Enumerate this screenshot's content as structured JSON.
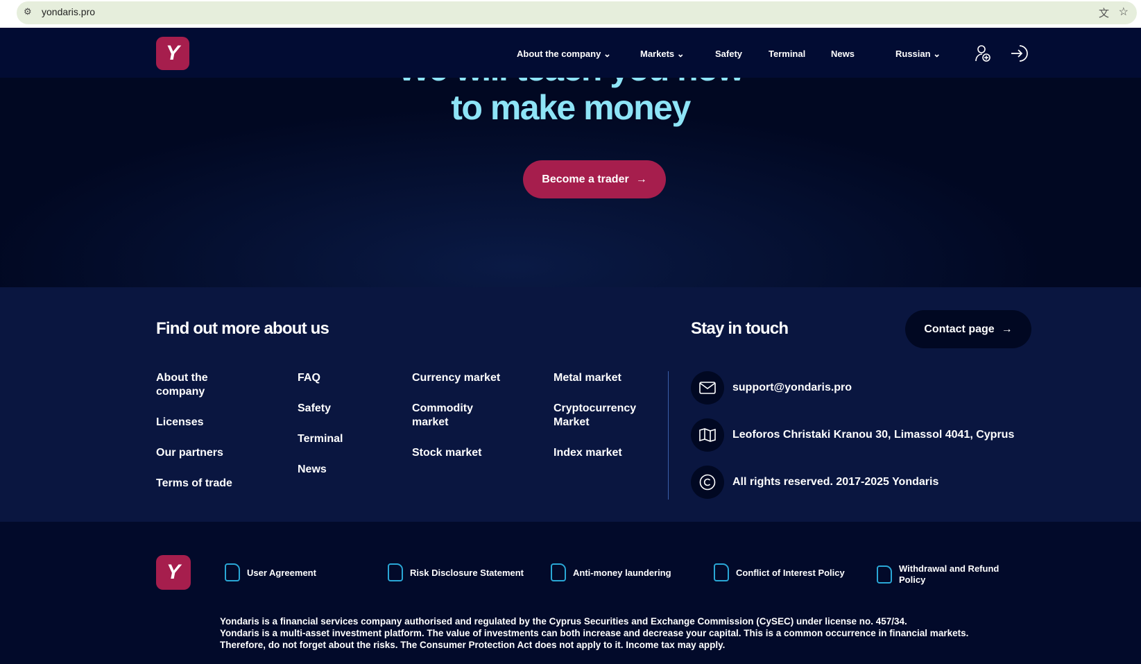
{
  "browser": {
    "url": "yondaris.pro"
  },
  "nav": {
    "logo": "Y",
    "items": [
      {
        "label": "About the company"
      },
      {
        "label": "Markets"
      },
      {
        "label": "Safety"
      },
      {
        "label": "Terminal"
      },
      {
        "label": "News"
      }
    ],
    "language": "Russian"
  },
  "hero": {
    "title_line1": "We will teach you how",
    "title_line2": "to make money",
    "cta": "Become a trader"
  },
  "footer": {
    "about_title": "Find out more about us",
    "columns": [
      [
        "About the company",
        "Licenses",
        "Our partners",
        "Terms of trade"
      ],
      [
        "FAQ",
        "Safety",
        "Terminal",
        "News"
      ],
      [
        "Currency market",
        "Commodity market",
        "Stock market"
      ],
      [
        "Metal market",
        "Cryptocurrency Market",
        "Index market"
      ]
    ],
    "contact_title": "Stay in touch",
    "contact_button": "Contact page",
    "email": "support@yondaris.pro",
    "address": "Leoforos Christaki Kranou 30, Limassol 4041, Cyprus",
    "copyright": "All rights reserved. 2017-2025 Yondaris"
  },
  "documents": [
    "User Agreement",
    "Risk Disclosure Statement",
    "Anti-money laundering",
    "Conflict of Interest Policy",
    "Withdrawal and Refund Policy"
  ],
  "disclaimer": [
    "Yondaris is a financial services company authorised and regulated by the Cyprus Securities and Exchange Commission (CySEC) under license no. 457/34.",
    "Yondaris is a multi-asset investment platform. The value of investments can both increase and decrease your capital. This is a common occurrence in financial markets.",
    "Therefore, do not forget about the risks. The Consumer Protection Act does not apply to it. Income tax may apply."
  ],
  "colors": {
    "accent": "#a61e4d",
    "hero_text": "#8ee4f7",
    "nav_bg": "#020c33",
    "footer_bg": "#0a1640"
  }
}
